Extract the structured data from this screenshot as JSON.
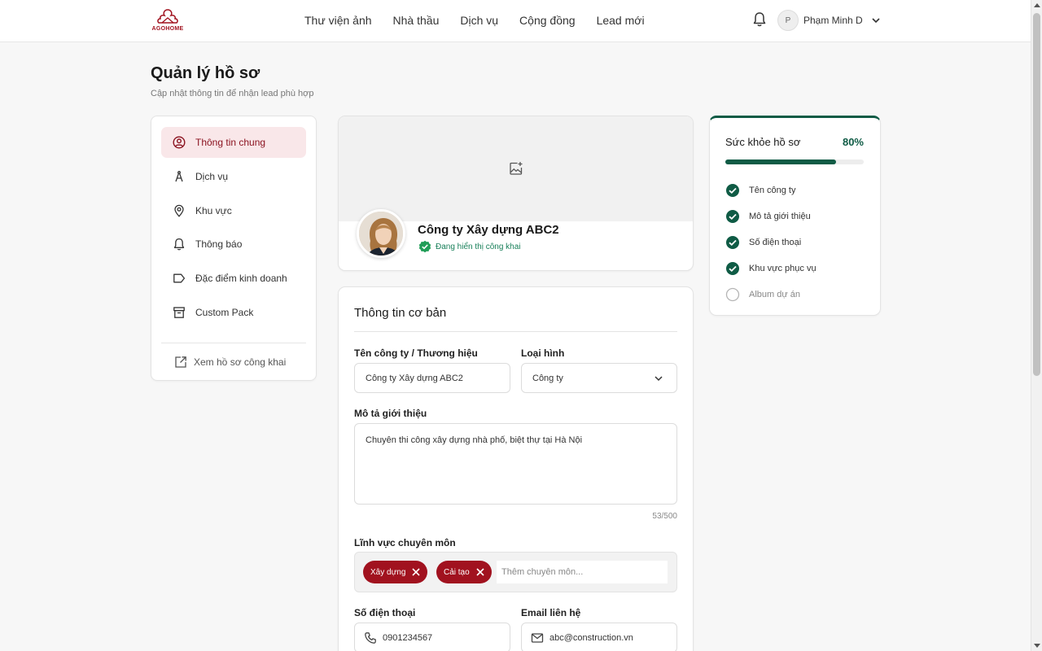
{
  "brand": {
    "name": "AGOHOME",
    "color": "#a1121f"
  },
  "nav": {
    "items": [
      "Thư viện ảnh",
      "Nhà thầu",
      "Dịch vụ",
      "Cộng đồng",
      "Lead mới"
    ]
  },
  "user": {
    "initial": "P",
    "name": "Phạm Minh D"
  },
  "page": {
    "title": "Quản lý hồ sơ",
    "subtitle": "Cập nhật thông tin để nhận lead phù hợp"
  },
  "sidebar": {
    "items": [
      {
        "label": "Thông tin chung",
        "icon": "user-circle-icon",
        "active": true
      },
      {
        "label": "Dịch vụ",
        "icon": "compass-tool-icon"
      },
      {
        "label": "Khu vực",
        "icon": "map-pin-icon"
      },
      {
        "label": "Thông báo",
        "icon": "bell-icon"
      },
      {
        "label": "Đặc điểm kinh doanh",
        "icon": "tag-icon"
      },
      {
        "label": "Custom Pack",
        "icon": "archive-icon"
      }
    ],
    "public_link": "Xem hồ sơ công khai"
  },
  "profile": {
    "company_name": "Công ty Xây dựng ABC2",
    "status": "Đang hiển thị công khai"
  },
  "form": {
    "title": "Thông tin cơ bản",
    "company_label": "Tên công ty / Thương hiệu",
    "company_value": "Công ty Xây dựng ABC2",
    "type_label": "Loại hình",
    "type_value": "Công ty",
    "description_label": "Mô tả giới thiệu",
    "description_value": "Chuyên thi công xây dựng nhà phố, biệt thự tại Hà Nội",
    "description_counter": "53/500",
    "specialty_label": "Lĩnh vực chuyên môn",
    "specialties": [
      "Xây dựng",
      "Cải tạo"
    ],
    "specialty_placeholder": "Thêm chuyên môn...",
    "phone_label": "Số điện thoại",
    "phone_value": "0901234567",
    "email_label": "Email liên hệ",
    "email_value": "abc@construction.vn"
  },
  "health": {
    "title": "Sức khỏe hồ sơ",
    "percent_text": "80%",
    "percent": 80,
    "accent": "#0f5b45",
    "items": [
      {
        "label": "Tên công ty",
        "done": true
      },
      {
        "label": "Mô tả giới thiệu",
        "done": true
      },
      {
        "label": "Số điện thoại",
        "done": true
      },
      {
        "label": "Khu vực phục vụ",
        "done": true
      },
      {
        "label": "Album dự án",
        "done": false
      }
    ]
  }
}
